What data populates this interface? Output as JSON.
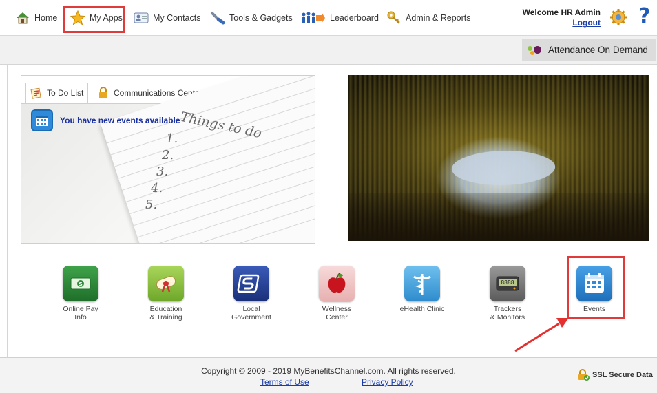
{
  "nav": {
    "items": [
      {
        "label": "Home",
        "icon": "home-icon"
      },
      {
        "label": "My Apps",
        "icon": "star-icon"
      },
      {
        "label": "My Contacts",
        "icon": "contacts-card-icon"
      },
      {
        "label": "Tools & Gadgets",
        "icon": "tools-icon"
      },
      {
        "label": "Leaderboard",
        "icon": "leaderboard-icon"
      },
      {
        "label": "Admin & Reports",
        "icon": "key-icon"
      }
    ],
    "welcome": "Welcome HR Admin",
    "logout": "Logout",
    "help": "?"
  },
  "subbar": {
    "attendance_button": "Attendance On Demand"
  },
  "panel": {
    "tabs": [
      {
        "label": "To Do List",
        "icon": "todo-list-icon",
        "active": true
      },
      {
        "label": "Communications Center",
        "icon": "lock-icon",
        "active": false
      }
    ],
    "notification": "You have new events available",
    "notebook_heading": "Things to do",
    "notebook_numbers": [
      "1.",
      "2.",
      "3.",
      "4.",
      "5."
    ]
  },
  "apps": [
    {
      "label": "Online Pay\nInfo",
      "icon": "money-icon",
      "color": "#2e8b3a"
    },
    {
      "label": "Education\n& Training",
      "icon": "diploma-icon",
      "color": "#8cc63e"
    },
    {
      "label": "Local\nGovernment",
      "icon": "government-icon",
      "color": "#2a4aa0"
    },
    {
      "label": "Wellness\nCenter",
      "icon": "apple-icon",
      "color": "#f2c6c6"
    },
    {
      "label": "eHealth Clinic",
      "icon": "caduceus-icon",
      "color": "#49a7df"
    },
    {
      "label": "Trackers\n& Monitors",
      "icon": "pedometer-icon",
      "color": "#7d7d7d"
    },
    {
      "label": "Events",
      "icon": "calendar-icon",
      "color": "#2f8bd9"
    }
  ],
  "footer": {
    "copyright": "Copyright © 2009 - 2019 MyBenefitsChannel.com. All rights reserved.",
    "terms": "Terms of Use",
    "privacy": "Privacy Policy",
    "ssl": "SSL Secure Data"
  },
  "colors": {
    "highlight": "#e03a3a",
    "link": "#1a3da8",
    "help": "#1e5bb8"
  }
}
